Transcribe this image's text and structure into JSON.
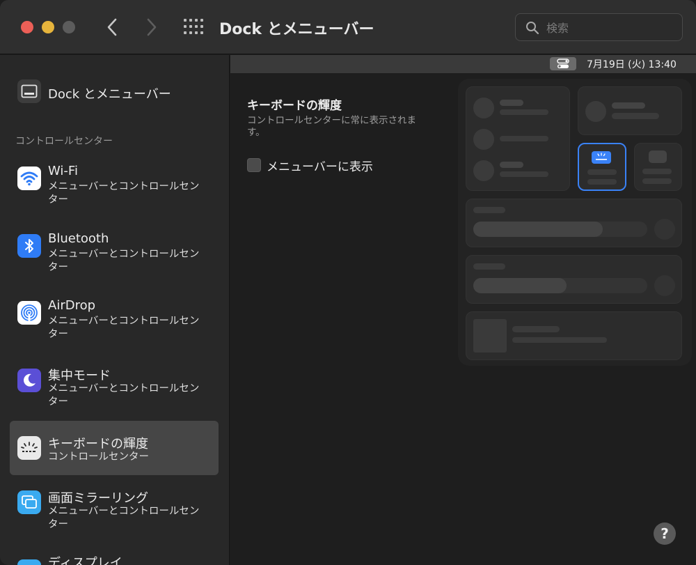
{
  "window": {
    "title": "Dock とメニューバー",
    "search_placeholder": "検索"
  },
  "sidebar": {
    "top_item": {
      "label": "Dock とメニューバー"
    },
    "section_header": "コントロールセンター",
    "items": [
      {
        "title": "Wi-Fi",
        "subtitle": "メニューバーとコントロールセンター",
        "icon": "wifi-icon"
      },
      {
        "title": "Bluetooth",
        "subtitle": "メニューバーとコントロールセンター",
        "icon": "bluetooth-icon"
      },
      {
        "title": "AirDrop",
        "subtitle": "メニューバーとコントロールセンター",
        "icon": "airdrop-icon"
      },
      {
        "title": "集中モード",
        "subtitle": "メニューバーとコントロールセンター",
        "icon": "moon-icon"
      },
      {
        "title": "キーボードの輝度",
        "subtitle": "コントロールセンター",
        "icon": "keyboard-brightness-icon",
        "selected": true
      },
      {
        "title": "画面ミラーリング",
        "subtitle": "メニューバーとコントロールセンター",
        "icon": "screen-mirroring-icon"
      },
      {
        "title": "ディスプレイ",
        "subtitle": "",
        "icon": "display-icon"
      }
    ]
  },
  "menubar_preview": {
    "date_time": "7月19日 (火)  13:40",
    "icon": "control-center-icon"
  },
  "detail": {
    "title": "キーボードの輝度",
    "description": "コントロールセンターに常に表示されます。",
    "checkbox_label": "メニューバーに表示",
    "checkbox_checked": false
  },
  "help_label": "?",
  "colors": {
    "accent": "#3a82f7",
    "selected_row": "#464646",
    "close": "#ec5f57",
    "minimize": "#e6b43c"
  }
}
